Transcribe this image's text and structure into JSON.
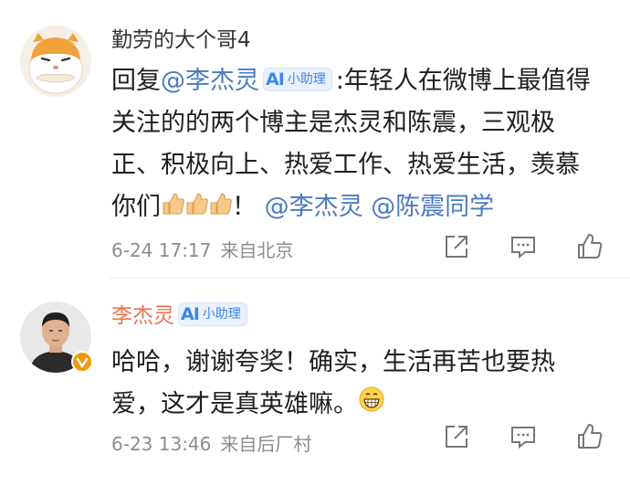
{
  "comments": [
    {
      "username": "勤劳的大个哥4",
      "reply_prefix": "回复",
      "reply_to": "@李杰灵",
      "ai_badge": {
        "logo": "AI",
        "label": "小助理"
      },
      "text": ":年轻人在微博上最值得关注的的两个博主是杰灵和陈震，三观极正、积极向上、热爱工作、热爱生活，羡慕你们",
      "emoji": "thumbs-up x3",
      "exclaim": "！",
      "mentions": [
        "@李杰灵",
        "@陈震同学"
      ],
      "time": "6-24 17:17",
      "location": "来自北京"
    },
    {
      "username": "李杰灵",
      "ai_badge": {
        "logo": "AI",
        "label": "小助理"
      },
      "text": "哈哈，谢谢夸奖！确实，生活再苦也要热爱，这才是真英雄嘛。",
      "emoji": "grin",
      "time": "6-23 13:46",
      "location": "来自后厂村"
    }
  ],
  "colors": {
    "mention": "#4a7bbf",
    "author_name": "#eb7350",
    "meta": "#8c8c8c",
    "ai_badge": "#3c86e8"
  },
  "icons": [
    "share-icon",
    "comment-icon",
    "like-icon",
    "verified-badge-icon"
  ]
}
